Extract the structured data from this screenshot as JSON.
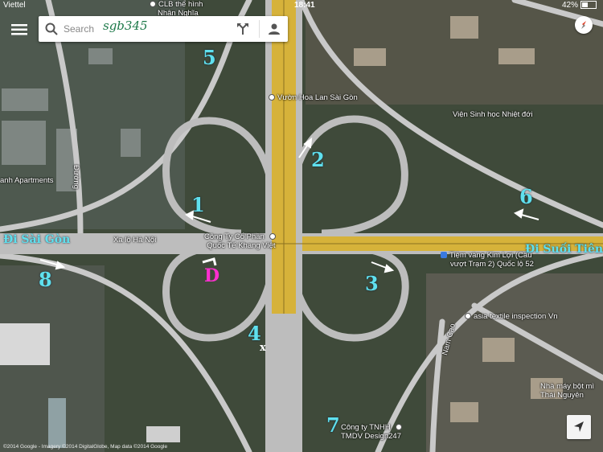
{
  "status_bar": {
    "carrier": "Viettel",
    "time": "18:41",
    "battery": "42%"
  },
  "search": {
    "placeholder": "Search"
  },
  "watermark": "sgb345",
  "route_numbers": [
    "1",
    "2",
    "3",
    "4",
    "5",
    "6",
    "7",
    "8"
  ],
  "direction_labels": {
    "west": "Đi Sài Gòn",
    "east": "Đi Suối Tiên"
  },
  "marks": {
    "d": "D",
    "x": "x"
  },
  "places": {
    "clb": [
      "CLB thể hình",
      "Nhân Nghĩa"
    ],
    "garden": "Vườn Hoa Lan Sài Gòn",
    "institute": "Viện Sinh học Nhiệt đới",
    "company_khang_viet": [
      "Công Ty Cổ Phần",
      "Quốc Tế Khang Việt"
    ],
    "xa_lo": "Xa lộ Hà Nội",
    "jewelry": [
      "Tiệm vàng Kim Lợi (Cầu",
      "vượt Trạm 2) Quốc lộ 52"
    ],
    "textile": "asia textile inspection Vn",
    "factory": [
      "Nhà máy bột mì",
      "Thái Nguyên"
    ],
    "tmdv": [
      "Công ty TNHH",
      "TMDV Design247"
    ],
    "apartments": "anh Apartments",
    "duong": "Đường",
    "nam_cao": "Nam Cao"
  },
  "attribution": "©2014 Google - Imagery ©2014 DigitalGlobe, Map data ©2014 Google",
  "colors": {
    "highway": "#d6b23a",
    "ramp": "#bdbdbd",
    "label_cyan": "#5fe0ee",
    "marker_magenta": "#ff2fd0"
  }
}
